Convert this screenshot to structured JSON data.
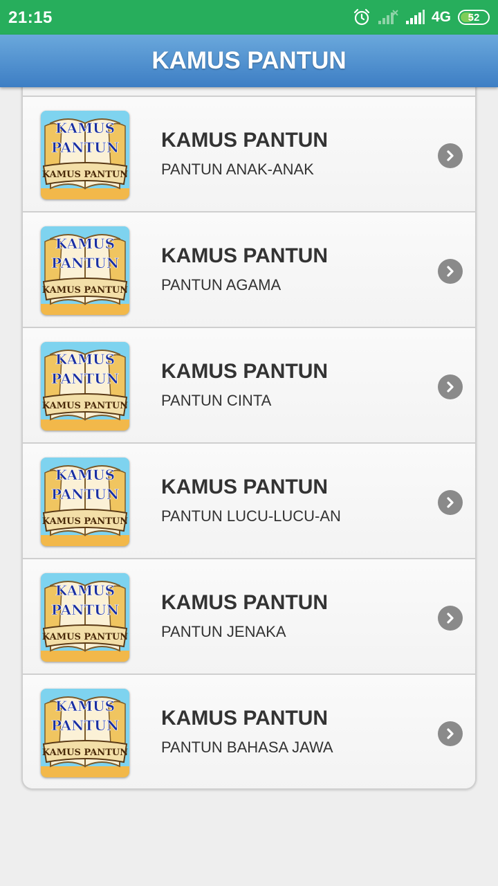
{
  "status_bar": {
    "time": "21:15",
    "network": "4G",
    "battery": "52",
    "battery_level": 0.52,
    "icons": [
      "alarm-icon",
      "signal-no-service-icon",
      "signal-icon",
      "battery-icon"
    ]
  },
  "app_bar": {
    "title": "KAMUS PANTUN"
  },
  "list": {
    "items": [
      {
        "title": "KAMUS PANTUN",
        "subtitle": "PANTUN ANAK-ANAK"
      },
      {
        "title": "KAMUS PANTUN",
        "subtitle": "PANTUN AGAMA"
      },
      {
        "title": "KAMUS PANTUN",
        "subtitle": "PANTUN CINTA"
      },
      {
        "title": "KAMUS PANTUN",
        "subtitle": "PANTUN LUCU-LUCU-AN"
      },
      {
        "title": "KAMUS PANTUN",
        "subtitle": "PANTUN JENAKA"
      },
      {
        "title": "KAMUS PANTUN",
        "subtitle": "PANTUN BAHASA JAWA"
      }
    ],
    "thumbnail_logo": {
      "line1": "KAMUS",
      "line2": "PANTUN",
      "banner": "KAMUS PANTUN"
    },
    "chevron_icon": "chevron-right-circle-icon"
  },
  "colors": {
    "status_bar": "#27ae5c",
    "app_bar_top": "#6aa8dc",
    "app_bar_bottom": "#3d7ec4",
    "chevron": "#8a8a8a"
  }
}
